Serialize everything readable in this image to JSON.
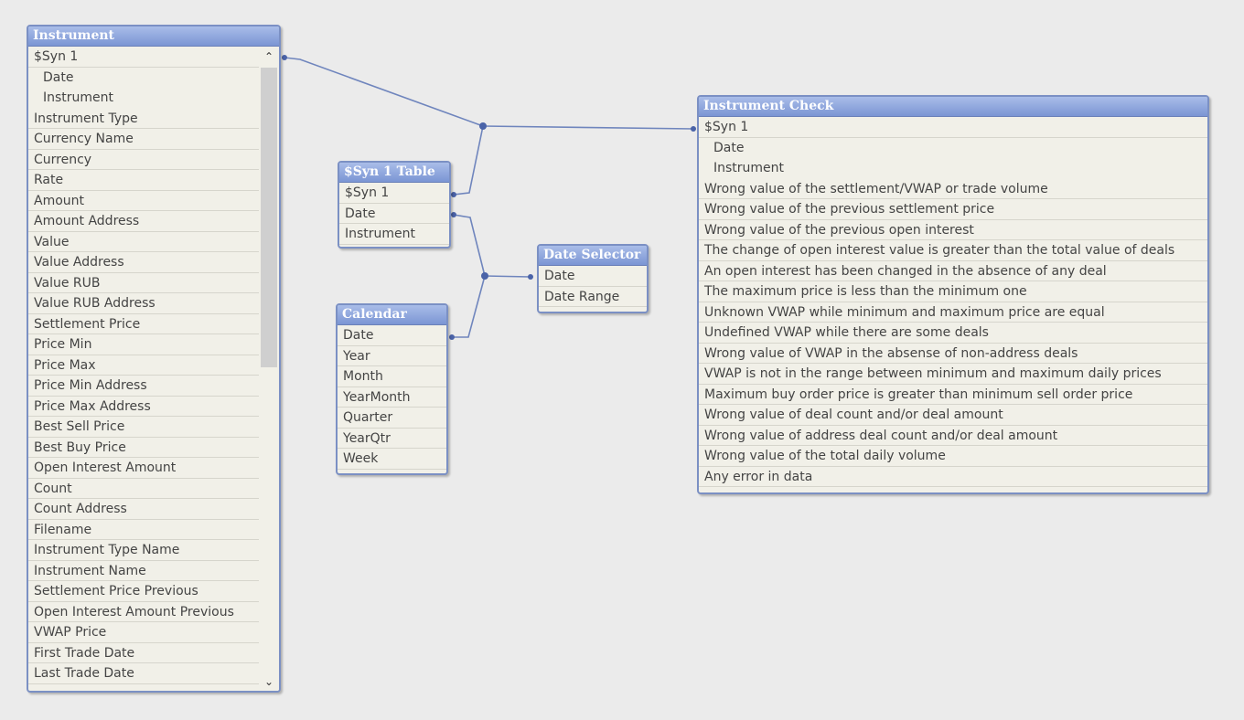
{
  "tables": {
    "instrument": {
      "title": "Instrument",
      "fields": [
        "$Syn 1",
        "Date",
        "Instrument",
        "Instrument Type",
        "Currency Name",
        "Currency",
        "Rate",
        "Amount",
        "Amount Address",
        "Value",
        "Value Address",
        "Value RUB",
        "Value RUB Address",
        "Settlement Price",
        "Price Min",
        "Price Max",
        "Price Min Address",
        "Price Max Address",
        "Best Sell Price",
        "Best Buy Price",
        "Open Interest Amount",
        "Count",
        "Count Address",
        "Filename",
        "Instrument Type Name",
        "Instrument Name",
        "Settlement Price Previous",
        "Open Interest Amount Previous",
        "VWAP Price",
        "First Trade Date",
        "Last Trade Date"
      ]
    },
    "syn1": {
      "title": "$Syn 1 Table",
      "fields": [
        "$Syn 1",
        "Date",
        "Instrument"
      ]
    },
    "calendar": {
      "title": "Calendar",
      "fields": [
        "Date",
        "Year",
        "Month",
        "YearMonth",
        "Quarter",
        "YearQtr",
        "Week"
      ]
    },
    "date_selector": {
      "title": "Date Selector",
      "fields": [
        "Date",
        "Date Range"
      ]
    },
    "instrument_check": {
      "title": "Instrument Check",
      "fields": [
        "$Syn 1",
        "Date",
        "Instrument",
        "Wrong value of the settlement/VWAP or trade volume",
        "Wrong value of the previous settlement price",
        "Wrong value of the previous open interest",
        "The change of open interest value is greater than the total value of deals",
        "An open interest has been changed in the absence of any deal",
        "The maximum price is less than the minimum one",
        "Unknown VWAP while minimum and maximum price are equal",
        "Undefined VWAP while there are some deals",
        "Wrong value of VWAP in the absense of non-address deals",
        "VWAP is not in the range between minimum and maximum daily prices",
        "Maximum buy order price is greater than minimum sell order price",
        "Wrong value of deal count and/or deal amount",
        "Wrong value of address deal count and/or deal amount",
        "Wrong value of the total daily volume",
        "Any error in data"
      ]
    }
  },
  "colors": {
    "background": "#ebebeb",
    "header": "#7b95d4",
    "link": "#6f85bd"
  },
  "icons": {
    "scroll_up": "chevron-up-icon",
    "scroll_down": "chevron-down-icon"
  }
}
